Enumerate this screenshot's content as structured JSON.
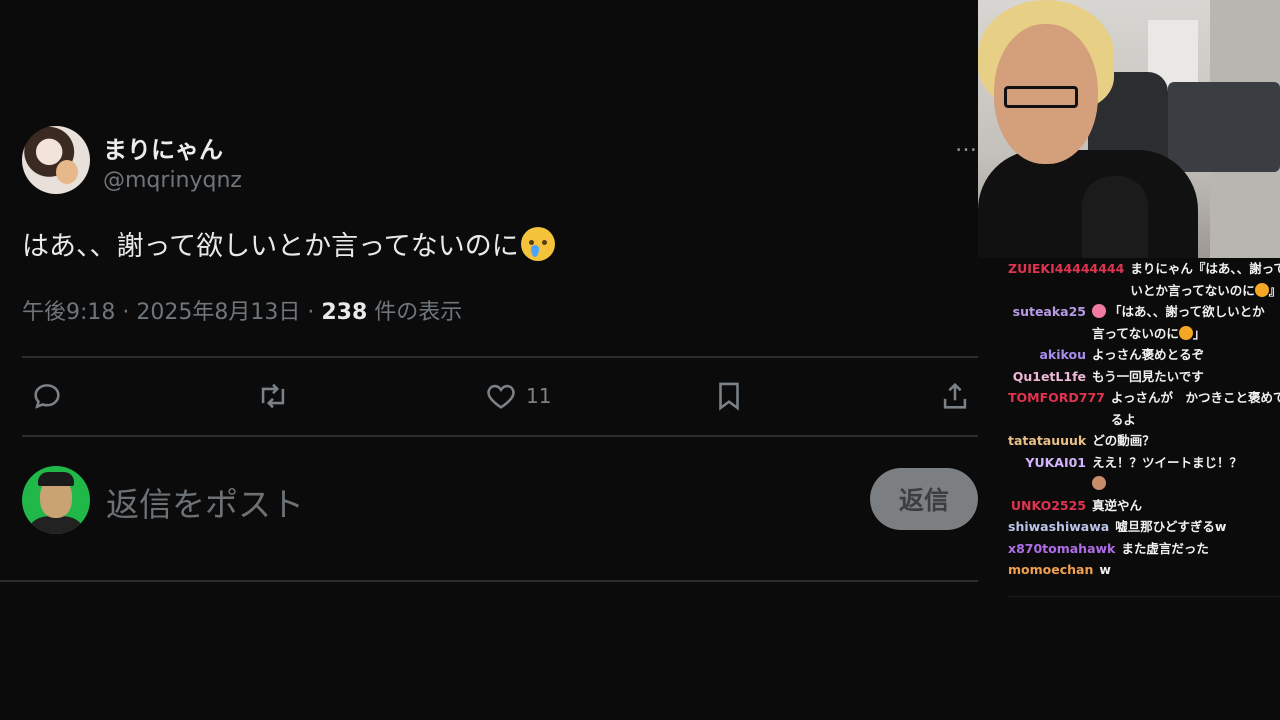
{
  "tweet": {
    "display_name": "まりにゃん",
    "handle": "@mqrinyqnz",
    "more_icon": "…",
    "text": "はあ、、謝って欲しいとか言ってないのに",
    "text_emoji": "crying-face-icon",
    "meta_time": "午後9:18 · 2025年8月13日 · ",
    "views_count": "238",
    "views_label": " 件の表示",
    "actions": {
      "reply_icon": "reply-icon",
      "retweet_icon": "retweet-icon",
      "like_icon": "heart-icon",
      "like_count": "11",
      "bookmark_icon": "bookmark-icon",
      "share_icon": "share-icon"
    },
    "reply_placeholder": "返信をポスト",
    "reply_button": "返信"
  },
  "chat": {
    "messages": [
      {
        "user": "ZUIEKI44444444",
        "color": "#e0334f",
        "text": "まりにゃん『はあ、、謝って欲しいとか言ってないのに",
        "text2": "』",
        "emoji": "#f5a623"
      },
      {
        "user": "suteaka25",
        "color": "#b99ae6",
        "text": "「はあ、、謝って欲しいとか言ってないのに",
        "text2": "」",
        "emoji": "#f5a623",
        "prefix_emoji": "#f07aa0"
      },
      {
        "user": "akikou",
        "color": "#a98ef0",
        "text": "よっさん褒めとるぞ"
      },
      {
        "user": "Qu1etL1fe",
        "color": "#f0b8d8",
        "text": "もう一回見たいです"
      },
      {
        "user": "TOMFORD777",
        "color": "#e0334f",
        "text": "よっさんが　かつきこと褒めてるよ"
      },
      {
        "user": "tatatauuuk",
        "color": "#e8c088",
        "text": "どの動画？"
      },
      {
        "user": "YUKAI01",
        "color": "#d4b4ff",
        "text": "ええ！？ツイートまじ！？",
        "emoji": "#c98c6a"
      },
      {
        "user": "UNKO2525",
        "color": "#e0334f",
        "text": "真逆やん"
      },
      {
        "user": "shiwashiwawa",
        "color": "#b9c4e8",
        "text": "嘘旦那ひどすぎるw"
      },
      {
        "user": "x870tomahawk",
        "color": "#b06de8",
        "text": "また虚言だった"
      },
      {
        "user": "momoechan",
        "color": "#f0a050",
        "text": "w"
      }
    ]
  }
}
